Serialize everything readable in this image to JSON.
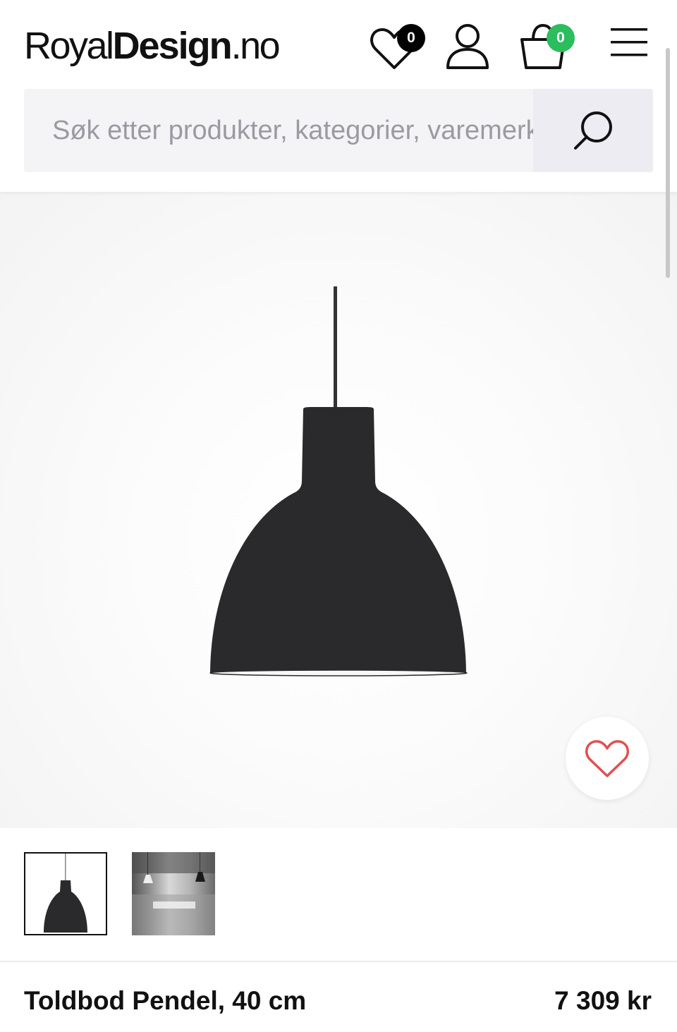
{
  "header": {
    "logo": {
      "part1": "Royal",
      "part2": "Design",
      "part3": ".no"
    },
    "wishlist_count": "0",
    "cart_count": "0"
  },
  "search": {
    "placeholder": "Søk etter produkter, kategorier, varemerker..."
  },
  "product": {
    "name": "Toldbod Pendel, 40 cm",
    "price": "7 309 kr"
  },
  "colors": {
    "cart_badge": "#2bbd5e",
    "wishlist_badge": "#000000",
    "favorite_heart": "#e0504f",
    "search_bg": "#f4f4f7"
  }
}
